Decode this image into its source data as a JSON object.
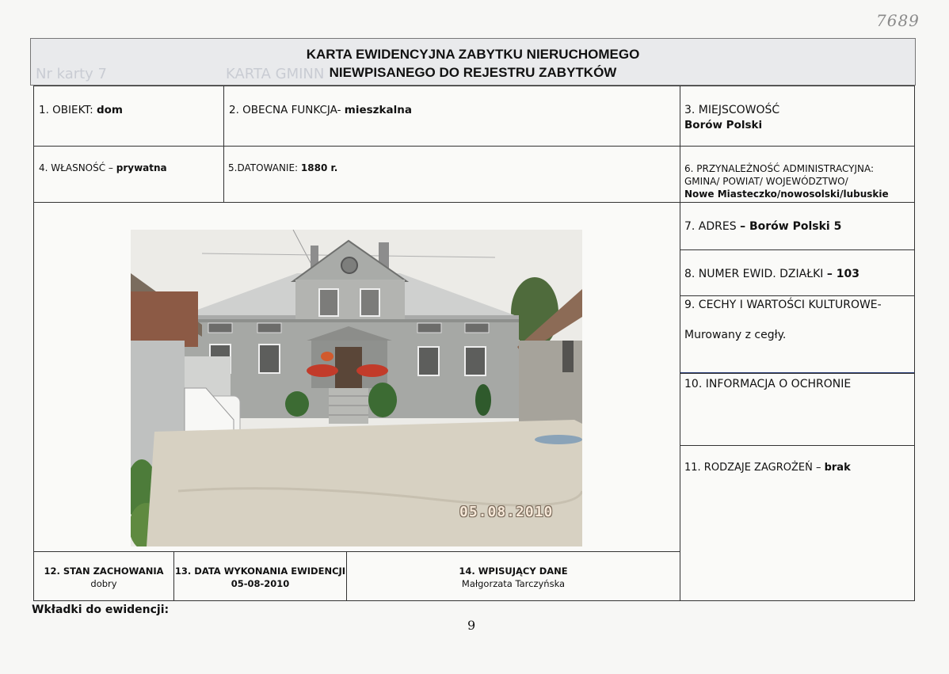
{
  "handwritten_number": "7689",
  "header": {
    "ghost_left": "Nr karty 7",
    "ghost_right": "KARTA GMINN",
    "title_line1": "KARTA EWIDENCYJNA ZABYTKU NIERUCHOMEGO",
    "title_line2": "NIEWPISANEGO DO REJESTRU ZABYTKÓW"
  },
  "fields": {
    "obiekt_label": "1. OBIEKT:",
    "obiekt_value": "dom",
    "funkcja_label": "2. OBECNA FUNKCJA-",
    "funkcja_value": "mieszkalna",
    "miejscowosc_label": "3. MIEJSCOWOŚĆ",
    "miejscowosc_value": "Borów Polski",
    "wlasnosc_label": "4. WŁASNOŚĆ –",
    "wlasnosc_value": "prywatna",
    "datowanie_label": "5.DATOWANIE:",
    "datowanie_value": "1880 r.",
    "przynaleznosc_label": "6. PRZYNALEŻNOŚĆ ADMINISTRACYJNA:",
    "przynaleznosc_sub": "GMINA/ POWIAT/ WOJEWÓDZTWO/",
    "przynaleznosc_value": "Nowe Miasteczko/nowosolski/lubuskie",
    "adres_label": "7. ADRES",
    "adres_value": "– Borów Polski 5",
    "dzialka_label": "8. NUMER EWID. DZIAŁKI",
    "dzialka_value": "– 103",
    "cechy_label": "9. CECHY  I WARTOŚCI KULTUROWE-",
    "cechy_value": "Murowany z cegły.",
    "ochrona_label": "10. INFORMACJA O OCHRONIE",
    "zagrozenia_label": "11. RODZAJE ZAGROŻEŃ –",
    "zagrozenia_value": "brak"
  },
  "photo": {
    "date_stamp": "05.08.2010"
  },
  "footer": {
    "stan_label": "12. STAN ZACHOWANIA",
    "stan_value": "dobry",
    "data_label": "13. DATA WYKONANIA EWIDENCJI",
    "data_value": "05-08-2010",
    "wpisujacy_label": "14. WPISUJĄCY DANE",
    "wpisujacy_value": "Małgorzata Tarczyńska"
  },
  "wkladki": "Wkładki do ewidencji:",
  "page_number": "9"
}
